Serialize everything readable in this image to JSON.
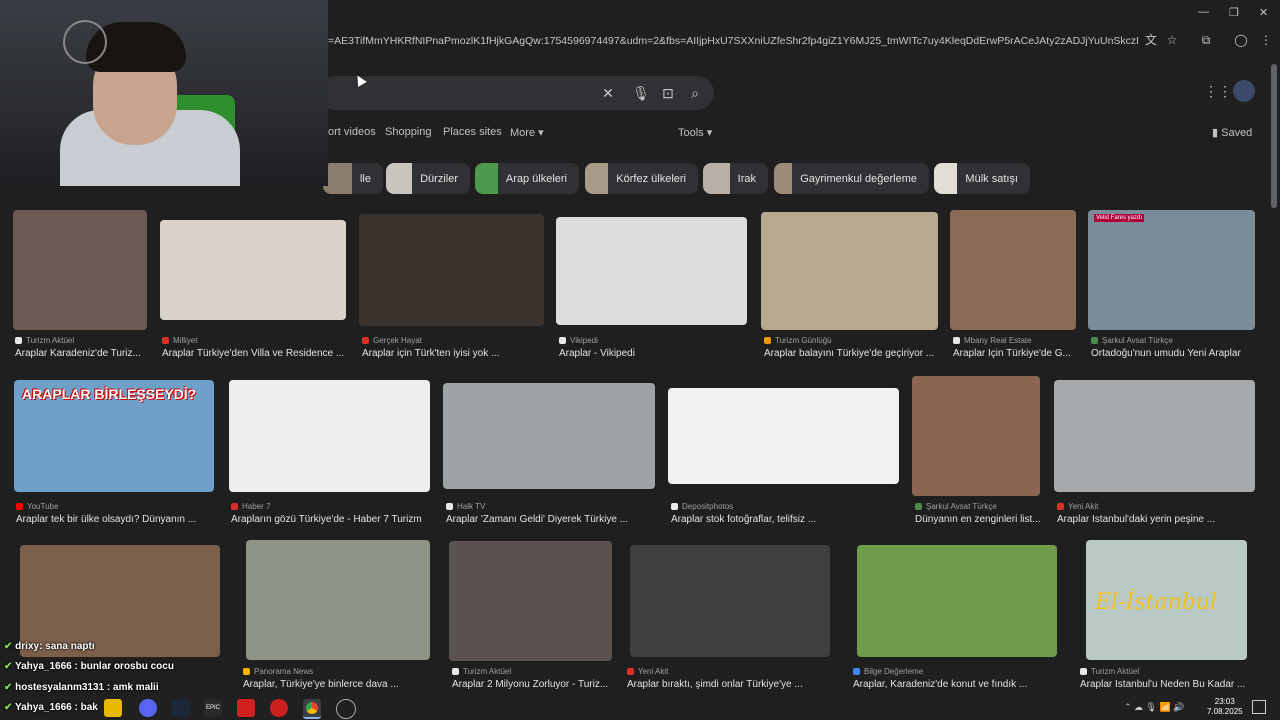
{
  "browser": {
    "url": "=AE3TifMmYHKRfNIPnaPmozlK1fHjkGAgQw:1754596974497&udm=2&fbs=AIIjpHxU7SXXniUZfeShr2fp4giZ1Y6MJ25_tmWITc7uy4KleqDdErwP5rACeJAty2zADJjYuUnSkczEhozYdaq1wZrEheAY38Uj...",
    "saved_label": "Saved"
  },
  "search": {
    "nav_tabs": [
      "ort videos",
      "Shopping",
      "Places sites",
      "More",
      "Tools"
    ]
  },
  "chips": [
    "lle",
    "Dürziler",
    "Arap ülkeleri",
    "Körfez ülkeleri",
    "Irak",
    "Gayrimenkul değerleme",
    "Mülk satışı"
  ],
  "results": [
    {
      "source": "Turizm Aktüel",
      "caption": "Araplar Karadeniz'de Turiz...",
      "src_color": "#e8e8e8",
      "img": "#6b5a55"
    },
    {
      "source": "Milliyet",
      "caption": "Araplar Türkiye'den Villa ve Residence ...",
      "src_color": "#d93025",
      "img": "#d9d3cc"
    },
    {
      "source": "Gerçek Hayat",
      "caption": "Araplar için Türk'ten iyisi yok ...",
      "src_color": "#d93025",
      "img": "#3b342e"
    },
    {
      "source": "Vikipedi",
      "caption": "Araplar - Vikipedi",
      "src_color": "#e8e8e8",
      "img": "#dcdcdc"
    },
    {
      "source": "Turizm Günlüğü",
      "caption": "Araplar balayını Türkiye'de geçiriyor ...",
      "src_color": "#f29900",
      "img": "#b7a98f"
    },
    {
      "source": "Mbany Real Estate",
      "caption": "Araplar İçin Türkiye'de G...",
      "src_color": "#e8e8e8",
      "img": "#8a6b57"
    },
    {
      "source": "Şarkul Avsat Türkçe",
      "caption": "Ortadoğu'nun umudu Yeni Araplar",
      "src_color": "#4a8a4a",
      "img": "#7b8c99"
    },
    {
      "source": "YouTube",
      "caption": "Araplar tek bir ülke olsaydı? Dünyanın ...",
      "src_color": "#ff0000",
      "img": "#6fa0c9"
    },
    {
      "source": "Haber 7",
      "caption": "Arapların gözü Türkiye'de - Haber 7 Turizm",
      "src_color": "#d93025",
      "img": "#eeeeee"
    },
    {
      "source": "Halk TV",
      "caption": "Araplar 'Zamanı Geldi' Diyerek Türkiye ...",
      "src_color": "#e8e8e8",
      "img": "#9ea3a6"
    },
    {
      "source": "Depositphotos",
      "caption": "Araplar stok fotoğraflar, telifsiz ...",
      "src_color": "#e8e8e8",
      "img": "#f2f2f2"
    },
    {
      "source": "Şarkul Avsat Türkçe",
      "caption": "Dünyanın en zenginleri list...",
      "src_color": "#4a8a4a",
      "img": "#8a6650"
    },
    {
      "source": "Yeni Akit",
      "caption": "Araplar İstanbul'daki yerin peşine ...",
      "src_color": "#d93025",
      "img": "#a6a9ab"
    },
    {
      "source": "",
      "caption": "",
      "src_color": "#e8e8e8",
      "img": "#7c5f4a"
    },
    {
      "source": "Panorama News",
      "caption": "Araplar, Türkiye'ye binlerce dava ...",
      "src_color": "#f4b400",
      "img": "#8e9587"
    },
    {
      "source": "Turizm Aktüel",
      "caption": "Araplar 2 Milyonu Zorluyor - Turiz...",
      "src_color": "#e8e8e8",
      "img": "#5a524e"
    },
    {
      "source": "Yeni Akit",
      "caption": "Araplar bıraktı, şimdi onlar Türkiye'ye ...",
      "src_color": "#d93025",
      "img": "#3f3f3f"
    },
    {
      "source": "Bilge Değerleme",
      "caption": "Araplar, Karadeniz'de konut ve fındık ...",
      "src_color": "#4285f4",
      "img": "#6e9c4a"
    },
    {
      "source": "Turizm Aktüel",
      "caption": "Araplar İstanbul'u Neden Bu Kadar ...",
      "src_color": "#e8e8e8",
      "img": "#b9c9c6"
    }
  ],
  "image_texts": {
    "map_title": "ARAPLAR BİRLEŞSEYDİ?",
    "istanbul_text": "El-İstanbul",
    "watermark": "Velid Fares yazdı"
  },
  "chat": [
    {
      "user": "drixy",
      "msg": ": sana naptı"
    },
    {
      "user": "Yahya_1666",
      "msg": " : bunlar orosbu cocu"
    },
    {
      "user": "hostesyalanm3131",
      "msg": " : amk malii"
    },
    {
      "user": "Yahya_1666",
      "msg": " : bak"
    }
  ],
  "taskbar": {
    "time": "23:03",
    "date": "7.08.2025",
    "epic_label": "EPIC"
  }
}
